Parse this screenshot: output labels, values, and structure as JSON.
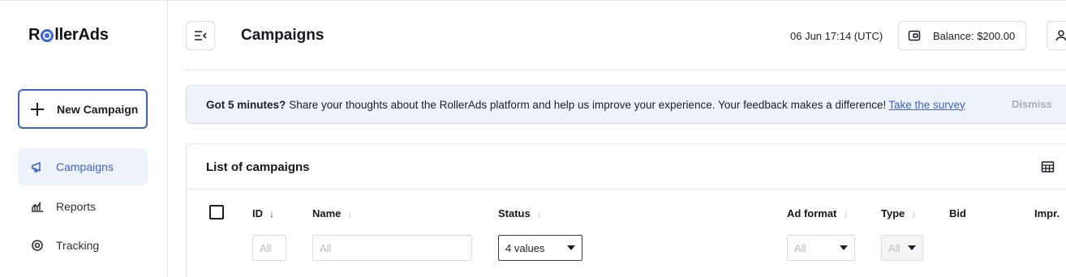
{
  "brand": {
    "logo_pre": "R",
    "logo_post": "llerAds",
    "accent": "#3d63c9"
  },
  "sidebar": {
    "new_campaign_label": "New Campaign",
    "items": [
      {
        "label": "Campaigns",
        "icon": "megaphone-icon",
        "active": true
      },
      {
        "label": "Reports",
        "icon": "chart-icon",
        "active": false
      },
      {
        "label": "Tracking",
        "icon": "target-icon",
        "active": false
      }
    ]
  },
  "header": {
    "title": "Campaigns",
    "datetime": "06 Jun 17:14 (UTC)",
    "balance_label": "Balance: $200.00"
  },
  "banner": {
    "bold": "Got 5 minutes?",
    "text": "Share your thoughts about the RollerAds platform and help us improve your experience. Your feedback makes a difference!",
    "link": "Take the survey",
    "dismiss": "Dismiss"
  },
  "list": {
    "title": "List of campaigns",
    "columns": [
      "ID",
      "Name",
      "Status",
      "Ad format",
      "Type",
      "Bid",
      "Impr."
    ],
    "filters": {
      "id_placeholder": "All",
      "name_placeholder": "All",
      "status_value": "4 values",
      "ad_format_value": "All",
      "type_value": "All"
    }
  }
}
